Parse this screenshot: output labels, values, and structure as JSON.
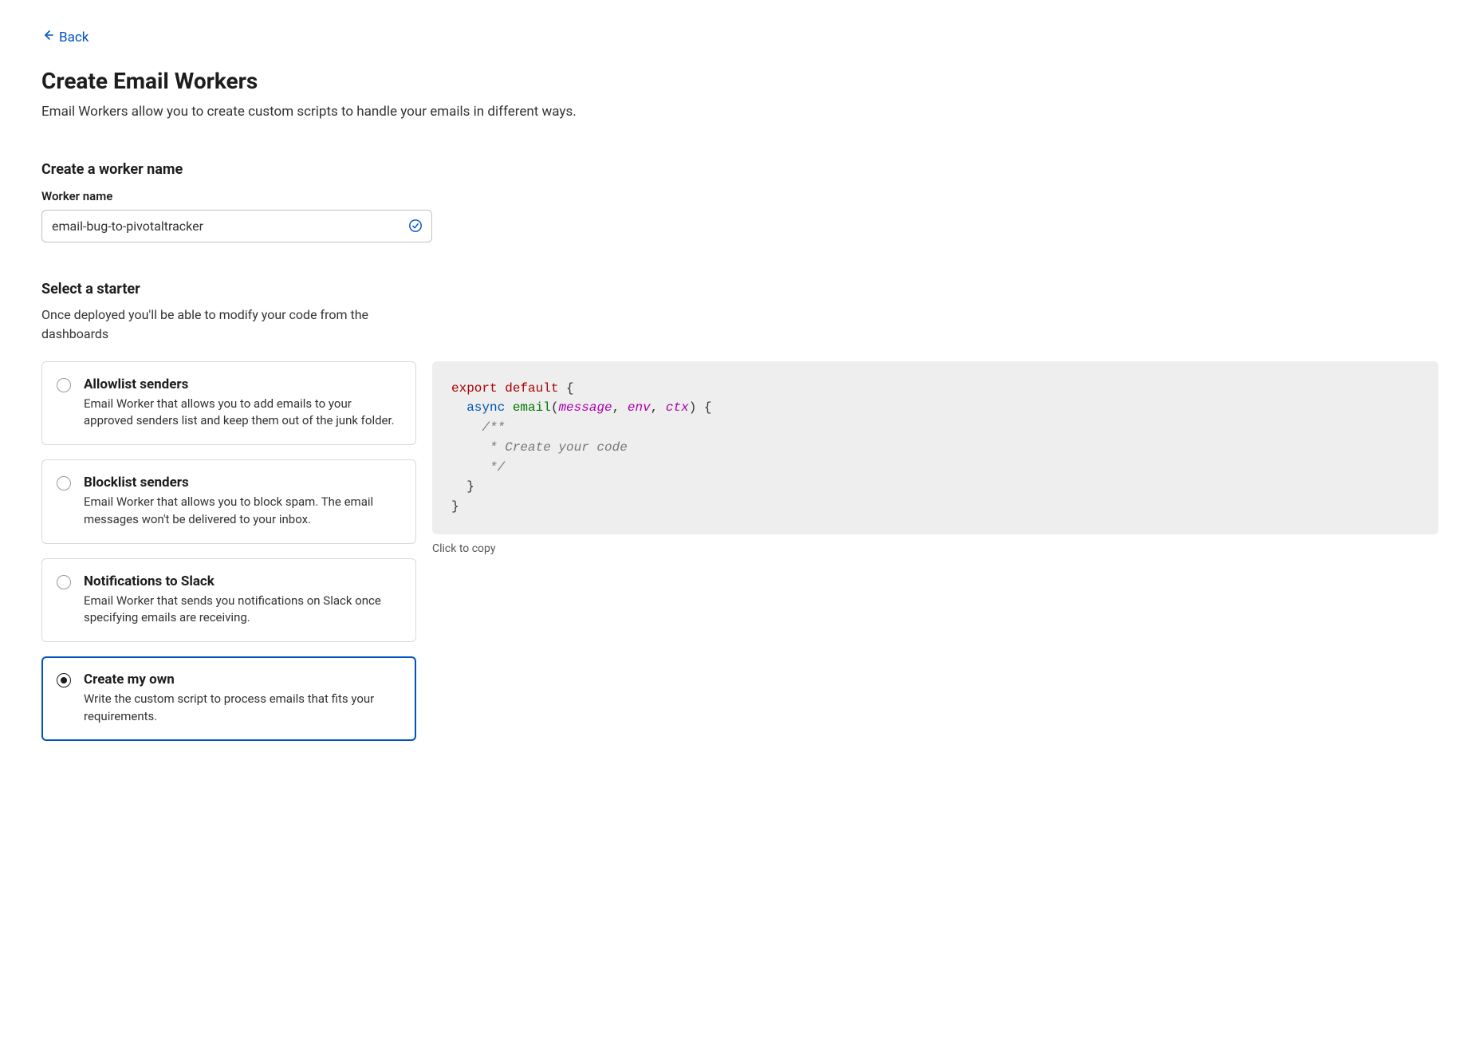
{
  "nav": {
    "back_label": "Back"
  },
  "header": {
    "title": "Create Email Workers",
    "subtitle": "Email Workers allow you to create custom scripts to handle your emails in different ways."
  },
  "form": {
    "name_section_heading": "Create a worker name",
    "name_label": "Worker name",
    "name_value": "email-bug-to-pivotaltracker"
  },
  "starter_section": {
    "heading": "Select a starter",
    "description": "Once deployed you'll be able to modify your code from the dashboards"
  },
  "starters": [
    {
      "id": "allowlist",
      "title": "Allowlist senders",
      "description": "Email Worker that allows you to add emails to your approved senders list and keep them out of the junk folder.",
      "selected": false
    },
    {
      "id": "blocklist",
      "title": "Blocklist senders",
      "description": "Email Worker that allows you to block spam. The email messages won't be delivered to your inbox.",
      "selected": false
    },
    {
      "id": "slack",
      "title": "Notifications to Slack",
      "description": "Email Worker that sends you notifications on Slack once specifying emails are receiving.",
      "selected": false
    },
    {
      "id": "custom",
      "title": "Create my own",
      "description": "Write the custom script to process emails that fits your requirements.",
      "selected": true
    }
  ],
  "code": {
    "tokens": {
      "export": "export",
      "default": "default",
      "brace_open": " {",
      "async": "  async",
      "fn": " email",
      "paren_open": "(",
      "param1": "message",
      "comma1": ", ",
      "param2": "env",
      "comma2": ", ",
      "param3": "ctx",
      "paren_close_brace": ") {",
      "comment_open": "    /**",
      "comment_line": "     * Create your code",
      "comment_close": "     */",
      "inner_close": "  }",
      "outer_close": "}"
    },
    "copy_hint": "Click to copy"
  },
  "colors": {
    "link": "#0051c3",
    "border": "#d9d9d9",
    "selected_border": "#0051c3",
    "code_bg": "#eeeeee"
  }
}
